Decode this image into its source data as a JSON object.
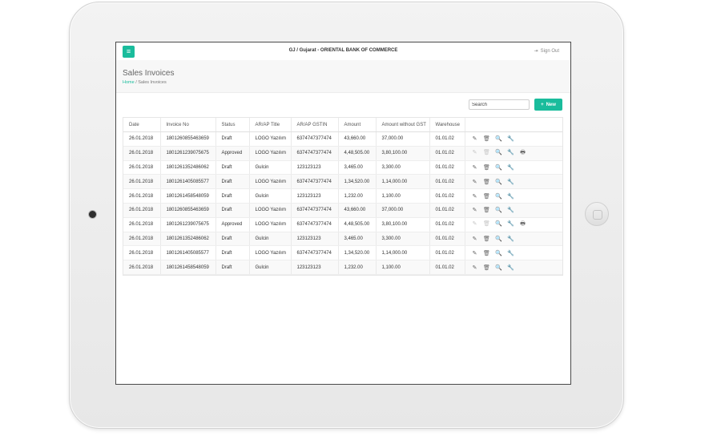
{
  "topbar": {
    "title": "GJ / Gujarat - ORIENTAL BANK OF COMMERCE",
    "signout": "Sign Out"
  },
  "page": {
    "title": "Sales Invoices",
    "breadcrumb_home": "Home",
    "breadcrumb_sep": "/",
    "breadcrumb_current": "Sales Invoices"
  },
  "toolbar": {
    "search_placeholder": "Search",
    "new_label": "New"
  },
  "table": {
    "headers": [
      "Date",
      "Invoice No",
      "Status",
      "AR/AP Title",
      "AR/AP GSTIN",
      "Amount",
      "Amount without GST",
      "Warehouse"
    ],
    "rows": [
      [
        "26.01.2018",
        "1801260855463659",
        "Draft",
        "LOGO Yazılım",
        "6374747377474",
        "43,660.00",
        "37,000.00",
        "01.01.02"
      ],
      [
        "26.01.2018",
        "1801261239075675",
        "Approved",
        "LOGO Yazılım",
        "6374747377474",
        "4,48,505.00",
        "3,80,100.00",
        "01.01.02"
      ],
      [
        "26.01.2018",
        "1801261352486062",
        "Draft",
        "Gulcin",
        "123123123",
        "3,465.00",
        "3,300.00",
        "01.01.02"
      ],
      [
        "26.01.2018",
        "1801261405085577",
        "Draft",
        "LOGO Yazılım",
        "6374747377474",
        "1,34,520.00",
        "1,14,000.00",
        "01.01.02"
      ],
      [
        "26.01.2018",
        "1801261458548059",
        "Draft",
        "Gulcin",
        "123123123",
        "1,232.00",
        "1,100.00",
        "01.01.02"
      ],
      [
        "26.01.2018",
        "1801260855463659",
        "Draft",
        "LOGO Yazılım",
        "6374747377474",
        "43,660.00",
        "37,000.00",
        "01.01.02"
      ],
      [
        "26.01.2018",
        "1801261239075675",
        "Approved",
        "LOGO Yazılım",
        "6374747377474",
        "4,48,505.00",
        "3,80,100.00",
        "01.01.02"
      ],
      [
        "26.01.2018",
        "1801261352486062",
        "Draft",
        "Gulcin",
        "123123123",
        "3,465.00",
        "3,300.00",
        "01.01.02"
      ],
      [
        "26.01.2018",
        "1801261405085577",
        "Draft",
        "LOGO Yazılım",
        "6374747377474",
        "1,34,520.00",
        "1,14,000.00",
        "01.01.02"
      ],
      [
        "26.01.2018",
        "1801261458548059",
        "Draft",
        "Gulcin",
        "123123123",
        "1,232.00",
        "1,100.00",
        "01.01.02"
      ]
    ]
  },
  "icons": {
    "edit": "✎",
    "delete": "🗑",
    "view": "🔍",
    "tools": "🔧",
    "print": "🖶",
    "menu": "≡",
    "signout": "⇥",
    "plus": "+"
  },
  "colors": {
    "accent": "#1abc9c"
  }
}
